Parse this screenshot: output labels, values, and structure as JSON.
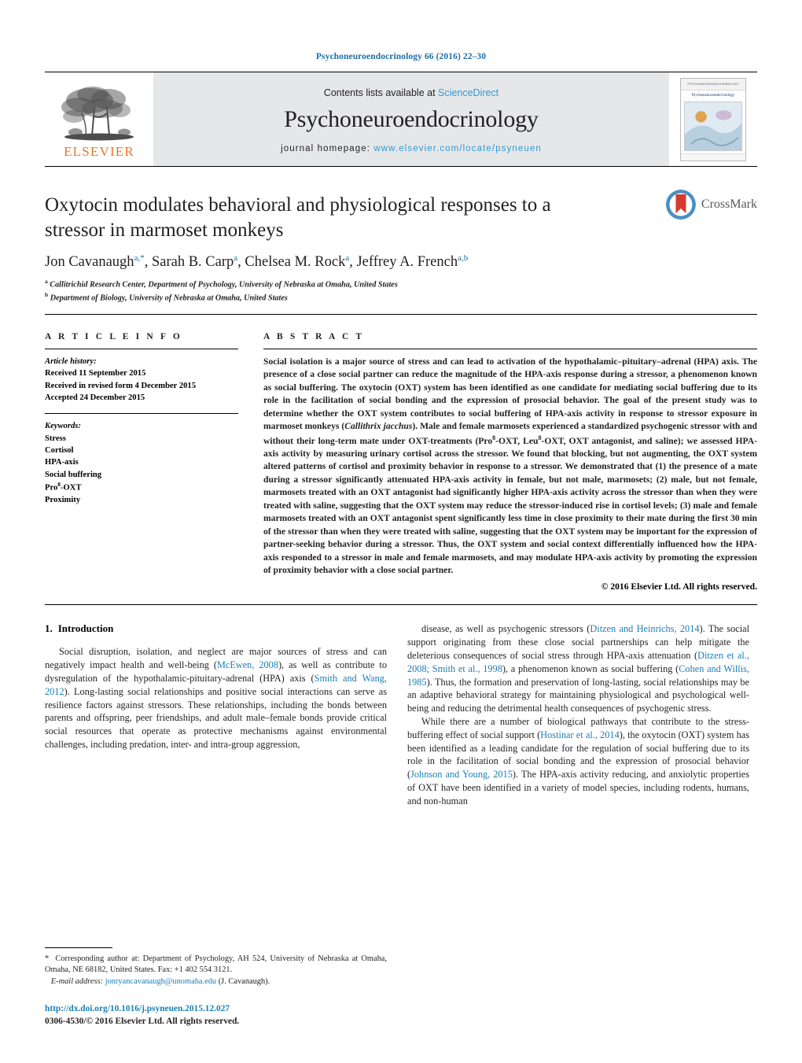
{
  "running_head": "Psychoneuroendocrinology 66 (2016) 22–30",
  "masthead": {
    "contents_prefix": "Contents lists available at",
    "contents_link": "ScienceDirect",
    "journal_title": "Psychoneuroendocrinology",
    "homepage_prefix": "journal homepage:",
    "homepage_url": "www.elsevier.com/locate/psyneuen",
    "publisher": "ELSEVIER",
    "publisher_logo": "elsevier-tree-logo",
    "cover_label": "PSYCHONEUROENDOCRINOLOGY",
    "cover_title": "Psychoneuroendocrinology"
  },
  "article": {
    "title": "Oxytocin modulates behavioral and physiological responses to a stressor in marmoset monkeys",
    "authors_html": "Jon Cavanaugh<sup>a,*</sup>, Sarah B. Carp<sup>a</sup>, Chelsea M. Rock<sup>a</sup>, Jeffrey A. French<sup>a,b</sup>",
    "affiliation_a": "Callitrichid Research Center, Department of Psychology, University of Nebraska at Omaha, United States",
    "affiliation_b": "Department of Biology, University of Nebraska at Omaha, United States",
    "crossmark_label": "CrossMark"
  },
  "info": {
    "heading": "A R T I C L E   I N F O",
    "history_label": "Article history:",
    "history": [
      "Received 11 September 2015",
      "Received in revised form 4 December 2015",
      "Accepted 24 December 2015"
    ],
    "keywords_label": "Keywords:",
    "keywords_html": [
      "Stress",
      "Cortisol",
      "HPA-axis",
      "Social buffering",
      "Pro<sup>8</sup>-OXT",
      "Proximity"
    ]
  },
  "abstract": {
    "heading": "A B S T R A C T",
    "text_html": "Social isolation is a major source of stress and can lead to activation of the hypothalamic–pituitary–adrenal (HPA) axis. The presence of a close social partner can reduce the magnitude of the HPA-axis response during a stressor, a phenomenon known as social buffering. The oxytocin (OXT) system has been identified as one candidate for mediating social buffering due to its role in the facilitation of social bonding and the expression of prosocial behavior. The goal of the present study was to determine whether the OXT system contributes to social buffering of HPA-axis activity in response to stressor exposure in marmoset monkeys (<i>Callithrix jacchus</i>). Male and female marmosets experienced a standardized psychogenic stressor with and without their long-term mate under OXT-treatments (Pro<sup>8</sup>-OXT, Leu<sup>8</sup>-OXT, OXT antagonist, and saline); we assessed HPA-axis activity by measuring urinary cortisol across the stressor. We found that blocking, but not augmenting, the OXT system altered patterns of cortisol and proximity behavior in response to a stressor. We demonstrated that (1) the presence of a mate during a stressor significantly attenuated HPA-axis activity in female, but not male, marmosets; (2) male, but not female, marmosets treated with an OXT antagonist had significantly higher HPA-axis activity across the stressor than when they were treated with saline, suggesting that the OXT system may reduce the stressor-induced rise in cortisol levels; (3) male and female marmosets treated with an OXT antagonist spent significantly less time in close proximity to their mate during the first 30 min of the stressor than when they were treated with saline, suggesting that the OXT system may be important for the expression of partner-seeking behavior during a stressor. Thus, the OXT system and social context differentially influenced how the HPA-axis responded to a stressor in male and female marmosets, and may modulate HPA-axis activity by promoting the expression of proximity behavior with a close social partner.",
    "copyright": "© 2016 Elsevier Ltd. All rights reserved."
  },
  "introduction": {
    "number": "1.",
    "heading": "Introduction",
    "left_paragraphs_html": [
      "Social disruption, isolation, and neglect are major sources of stress and can negatively impact health and well-being (<span class=\"cit\">McEwen, 2008</span>), as well as contribute to dysregulation of the hypothalamic-pituitary-adrenal (HPA) axis (<span class=\"cit\">Smith and Wang, 2012</span>). Long-lasting social relationships and positive social interactions can serve as resilience factors against stressors. These relationships, including the bonds between parents and offspring, peer friendships, and adult male–female bonds provide critical social resources that operate as protective mechanisms against environmental challenges, including predation, inter- and intra-group aggression,"
    ],
    "right_paragraphs_html": [
      "disease, as well as psychogenic stressors (<span class=\"cit\">Ditzen and Heinrichs, 2014</span>). The social support originating from these close social partnerships can help mitigate the deleterious consequences of social stress through HPA-axis attenuation (<span class=\"cit\">Ditzen et al., 2008; Smith et al., 1998</span>), a phenomenon known as social buffering (<span class=\"cit\">Cohen and Willis, 1985</span>). Thus, the formation and preservation of long-lasting, social relationships may be an adaptive behavioral strategy for maintaining physiological and psychological well-being and reducing the detrimental health consequences of psychogenic stress.",
      "While there are a number of biological pathways that contribute to the stress-buffering effect of social support (<span class=\"cit\">Hostinar et al., 2014</span>), the oxytocin (OXT) system has been identified as a leading candidate for the regulation of social buffering due to its role in the facilitation of social bonding and the expression of prosocial behavior (<span class=\"cit\">Johnson and Young, 2015</span>). The HPA-axis activity reducing, and anxiolytic properties of OXT have been identified in a variety of model species, including rodents, humans, and non-human"
    ]
  },
  "footnote": {
    "text_html": "<span class=\"star\">*</span> Corresponding author at: Department of Psychology, AH 524, University of Nebraska at Omaha, Omaha, NE 68182, United States. Fax: +1 402 554 3121.",
    "email_label": "E-mail address:",
    "email": "jonryancavanaugh@unomaha.edu",
    "email_suffix": "(J. Cavanaugh)."
  },
  "bottom": {
    "doi": "http://dx.doi.org/10.1016/j.psyneuen.2015.12.027",
    "issn_line": "0306-4530/© 2016 Elsevier Ltd. All rights reserved."
  },
  "colors": {
    "link_blue": "#1a7fb5",
    "header_blue": "#1a6fa8",
    "sciencedirect_blue": "#2e9bd6",
    "elsevier_orange": "#E87722",
    "masthead_gray": "#e6e7e8"
  }
}
